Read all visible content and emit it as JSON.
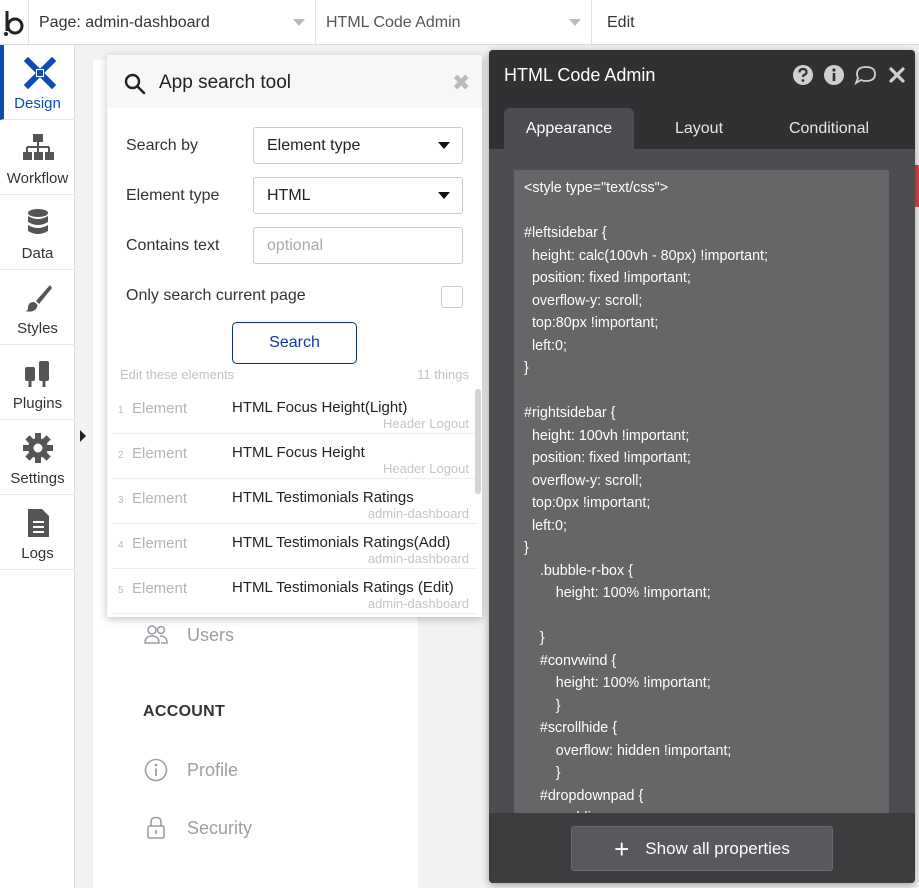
{
  "topbar": {
    "page_label": "Page: admin-dashboard",
    "element_label": "HTML Code Admin",
    "mode_label": "Edit"
  },
  "sidebar": {
    "items": [
      {
        "label": "Design",
        "icon": "design-icon",
        "active": true
      },
      {
        "label": "Workflow",
        "icon": "workflow-icon"
      },
      {
        "label": "Data",
        "icon": "database-icon"
      },
      {
        "label": "Styles",
        "icon": "brush-icon"
      },
      {
        "label": "Plugins",
        "icon": "plug-icon"
      },
      {
        "label": "Settings",
        "icon": "gear-icon"
      },
      {
        "label": "Logs",
        "icon": "document-icon"
      }
    ]
  },
  "canvas": {
    "nav_users": "Users",
    "section_account": "ACCOUNT",
    "nav_profile": "Profile",
    "nav_security": "Security"
  },
  "search_tool": {
    "title": "App search tool",
    "search_by_label": "Search by",
    "search_by_value": "Element type",
    "element_type_label": "Element type",
    "element_type_value": "HTML",
    "contains_text_label": "Contains text",
    "contains_text_placeholder": "optional",
    "only_current_page_label": "Only search current page",
    "search_button": "Search",
    "edit_elements_label": "Edit these elements",
    "count_label": "11 things",
    "results": [
      {
        "num": "1",
        "kind": "Element",
        "name": "HTML Focus Height(Light)",
        "page": "Header Logout"
      },
      {
        "num": "2",
        "kind": "Element",
        "name": "HTML Focus Height",
        "page": "Header Logout"
      },
      {
        "num": "3",
        "kind": "Element",
        "name": "HTML Testimonials Ratings",
        "page": "admin-dashboard"
      },
      {
        "num": "4",
        "kind": "Element",
        "name": "HTML Testimonials Ratings(Add)",
        "page": "admin-dashboard"
      },
      {
        "num": "5",
        "kind": "Element",
        "name": "HTML Testimonials Ratings (Edit)",
        "page": "admin-dashboard"
      }
    ]
  },
  "editor": {
    "title": "HTML Code Admin",
    "tabs": [
      "Appearance",
      "Layout",
      "Conditional"
    ],
    "code": "<style type=\"text/css\">\n\n#leftsidebar {\n  height: calc(100vh - 80px) !important;\n  position: fixed !important;\n  overflow-y: scroll;\n  top:80px !important;\n  left:0;\n}\n\n#rightsidebar {\n  height: 100vh !important;\n  position: fixed !important;\n  overflow-y: scroll;\n  top:0px !important;\n  left:0;\n}\n    .bubble-r-box {\n        height: 100% !important;\n\n    }\n    #convwind {\n        height: 100% !important;\n        }\n    #scrollhide {\n        overflow: hidden !important;\n        }\n    #dropdownpad {\n        padding",
    "show_all_button": "Show all properties"
  },
  "colors": {
    "accent": "#0d4bb5",
    "editor_bg": "#3b3d3f",
    "code_bg": "#646668"
  }
}
